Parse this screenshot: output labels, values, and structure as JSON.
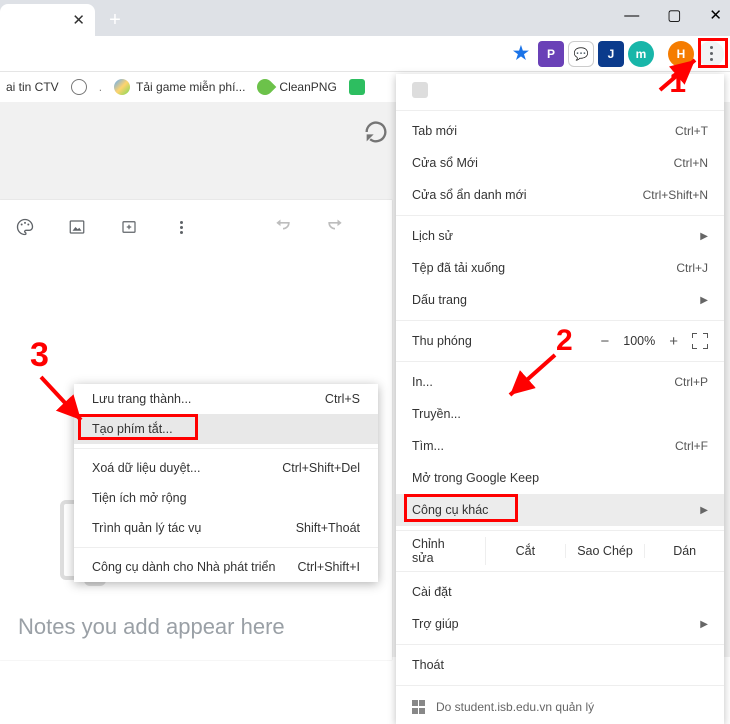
{
  "window_controls": {
    "min": "—",
    "max": "▢",
    "close": "✕"
  },
  "tab": {
    "close": "✕",
    "plus": "+"
  },
  "bookmarks": {
    "item1": "ai tin CTV",
    "item2": "Tải game miễn phí...",
    "item3": "CleanPNG"
  },
  "toolbar": {
    "p": "P",
    "j": "J",
    "m": "m",
    "h": "H"
  },
  "menu": {
    "new_tab": "Tab mới",
    "new_tab_sc": "Ctrl+T",
    "new_window": "Cửa sổ Mới",
    "new_window_sc": "Ctrl+N",
    "incognito": "Cửa sổ ẩn danh mới",
    "incognito_sc": "Ctrl+Shift+N",
    "history": "Lịch sử",
    "downloads": "Tệp đã tải xuống",
    "downloads_sc": "Ctrl+J",
    "bookmarks": "Dấu trang",
    "zoom_label": "Thu phóng",
    "zoom_minus": "−",
    "zoom_val": "100%",
    "zoom_plus": "+",
    "print": "In...",
    "print_sc": "Ctrl+P",
    "cast": "Truyền...",
    "find": "Tìm...",
    "find_sc": "Ctrl+F",
    "open_keep": "Mở trong Google Keep",
    "more_tools": "Công cụ khác",
    "edit_label": "Chỉnh sửa",
    "cut": "Cắt",
    "copy": "Sao Chép",
    "paste": "Dán",
    "settings": "Cài đặt",
    "help": "Trợ giúp",
    "exit": "Thoát",
    "managed": "Do student.isb.edu.vn quản lý"
  },
  "submenu": {
    "save_page": "Lưu trang thành...",
    "save_page_sc": "Ctrl+S",
    "shortcut": "Tạo phím tắt...",
    "clear_data": "Xoá dữ liệu duyệt...",
    "clear_data_sc": "Ctrl+Shift+Del",
    "extensions": "Tiện ích mở rộng",
    "taskmgr": "Trình quản lý tác vụ",
    "taskmgr_sc": "Shift+Thoát",
    "devtools": "Công cụ dành cho Nhà phát triển",
    "devtools_sc": "Ctrl+Shift+I"
  },
  "annotations": {
    "n1": "1",
    "n2": "2",
    "n3": "3"
  },
  "notes": {
    "message": "Notes you add appear here"
  }
}
